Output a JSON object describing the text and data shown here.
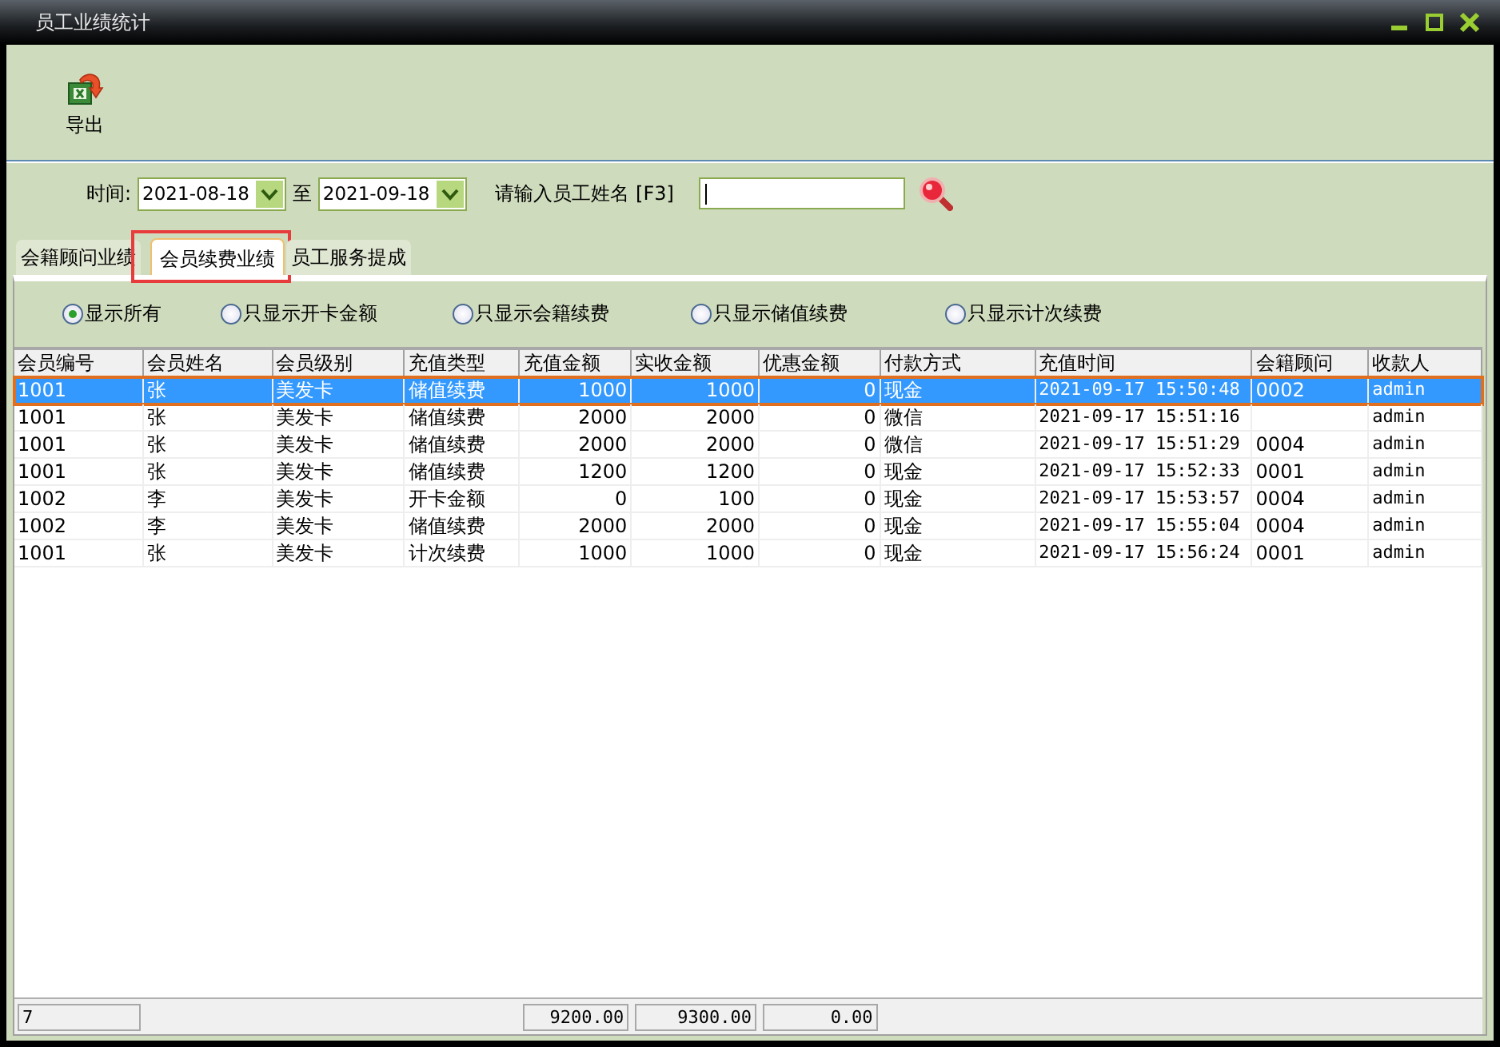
{
  "window": {
    "title": "员工业绩统计"
  },
  "toolbar": {
    "export_label": "导出"
  },
  "filter": {
    "time_label": "时间:",
    "start_date": "2021-08-18",
    "to_label": "至",
    "end_date": "2021-09-18",
    "name_label": "请输入员工姓名 [F3]"
  },
  "tabs": [
    {
      "label": "会籍顾问业绩",
      "selected": false,
      "highlighted": false
    },
    {
      "label": "会员续费业绩",
      "selected": true,
      "highlighted": true
    },
    {
      "label": "员工服务提成",
      "selected": false,
      "highlighted": false
    }
  ],
  "radios": [
    {
      "label": "显示所有",
      "selected": true
    },
    {
      "label": "只显示开卡金额",
      "selected": false
    },
    {
      "label": "只显示会籍续费",
      "selected": false
    },
    {
      "label": "只显示储值续费",
      "selected": false
    },
    {
      "label": "只显示计次续费",
      "selected": false
    }
  ],
  "table": {
    "columns": [
      {
        "label": "会员编号",
        "kind": "text",
        "total": "7"
      },
      {
        "label": "会员姓名",
        "kind": "text"
      },
      {
        "label": "会员级别",
        "kind": "text"
      },
      {
        "label": "充值类型",
        "kind": "text"
      },
      {
        "label": "充值金额",
        "kind": "number",
        "total": "9200.00"
      },
      {
        "label": "实收金额",
        "kind": "number",
        "total": "9300.00"
      },
      {
        "label": "优惠金额",
        "kind": "number",
        "total": "0.00"
      },
      {
        "label": "付款方式",
        "kind": "text"
      },
      {
        "label": "充值时间",
        "kind": "mono"
      },
      {
        "label": "会籍顾问",
        "kind": "text"
      },
      {
        "label": "收款人",
        "kind": "mono"
      }
    ],
    "rows": [
      {
        "selected": true,
        "cells": [
          "1001",
          "张",
          "美发卡",
          "储值续费",
          "1000",
          "1000",
          "0",
          "现金",
          "2021-09-17 15:50:48",
          "0002",
          "admin"
        ]
      },
      {
        "selected": false,
        "cells": [
          "1001",
          "张",
          "美发卡",
          "储值续费",
          "2000",
          "2000",
          "0",
          "微信",
          "2021-09-17 15:51:16",
          null,
          "admin"
        ]
      },
      {
        "selected": false,
        "cells": [
          "1001",
          "张",
          "美发卡",
          "储值续费",
          "2000",
          "2000",
          "0",
          "微信",
          "2021-09-17 15:51:29",
          "0004",
          "admin"
        ]
      },
      {
        "selected": false,
        "cells": [
          "1001",
          "张",
          "美发卡",
          "储值续费",
          "1200",
          "1200",
          "0",
          "现金",
          "2021-09-17 15:52:33",
          "0001",
          "admin"
        ]
      },
      {
        "selected": false,
        "cells": [
          "1002",
          "李",
          "美发卡",
          "开卡金额",
          "0",
          "100",
          "0",
          "现金",
          "2021-09-17 15:53:57",
          "0004",
          "admin"
        ]
      },
      {
        "selected": false,
        "cells": [
          "1002",
          "李",
          "美发卡",
          "储值续费",
          "2000",
          "2000",
          "0",
          "现金",
          "2021-09-17 15:55:04",
          "0004",
          "admin"
        ]
      },
      {
        "selected": false,
        "cells": [
          "1001",
          "张",
          "美发卡",
          "计次续费",
          "1000",
          "1000",
          "0",
          "现金",
          "2021-09-17 15:56:24",
          "0001",
          "admin"
        ]
      }
    ]
  }
}
